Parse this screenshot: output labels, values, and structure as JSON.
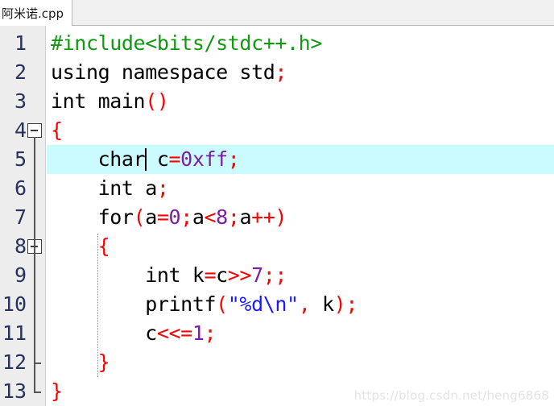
{
  "tab": {
    "label": "阿米诺.cpp"
  },
  "editor": {
    "highlighted_line": 5,
    "cursor_line": 5,
    "cursor_after_text": "    char",
    "colors": {
      "background": "#ffffff",
      "gutter_background": "#ededed",
      "line_number": "#26335c",
      "current_line_highlight": "#ccfbff",
      "preprocessor": "#119911",
      "punctuation": "#ff0000",
      "number": "#7b1fa2",
      "string": "#1a1aff",
      "plain": "#000000"
    },
    "lines": [
      {
        "number": "1",
        "fold": "none",
        "tokens": [
          {
            "text": "#include<bits/stdc++.h>",
            "type": "prep"
          }
        ]
      },
      {
        "number": "2",
        "fold": "none",
        "tokens": [
          {
            "text": "using namespace std",
            "type": "plain"
          },
          {
            "text": ";",
            "type": "punct"
          }
        ]
      },
      {
        "number": "3",
        "fold": "none",
        "tokens": [
          {
            "text": "int main",
            "type": "plain"
          },
          {
            "text": "()",
            "type": "punct"
          }
        ]
      },
      {
        "number": "4",
        "fold": "start",
        "tokens": [
          {
            "text": "{",
            "type": "punct"
          }
        ]
      },
      {
        "number": "5",
        "fold": "line",
        "tokens": [
          {
            "text": "    char c",
            "type": "plain"
          },
          {
            "text": "=",
            "type": "punct"
          },
          {
            "text": "0xff",
            "type": "num"
          },
          {
            "text": ";",
            "type": "punct"
          }
        ]
      },
      {
        "number": "6",
        "fold": "line",
        "tokens": [
          {
            "text": "    int a",
            "type": "plain"
          },
          {
            "text": ";",
            "type": "punct"
          }
        ]
      },
      {
        "number": "7",
        "fold": "line",
        "tokens": [
          {
            "text": "    for",
            "type": "plain"
          },
          {
            "text": "(",
            "type": "punct"
          },
          {
            "text": "a",
            "type": "plain"
          },
          {
            "text": "=",
            "type": "punct"
          },
          {
            "text": "0",
            "type": "num"
          },
          {
            "text": ";",
            "type": "punct"
          },
          {
            "text": "a",
            "type": "plain"
          },
          {
            "text": "<",
            "type": "punct"
          },
          {
            "text": "8",
            "type": "num"
          },
          {
            "text": ";",
            "type": "punct"
          },
          {
            "text": "a",
            "type": "plain"
          },
          {
            "text": "++)",
            "type": "punct"
          }
        ]
      },
      {
        "number": "8",
        "fold": "start",
        "tokens": [
          {
            "text": "    ",
            "type": "plain"
          },
          {
            "text": "{",
            "type": "punct"
          }
        ]
      },
      {
        "number": "9",
        "fold": "line",
        "tokens": [
          {
            "text": "        int k",
            "type": "plain"
          },
          {
            "text": "=",
            "type": "punct"
          },
          {
            "text": "c",
            "type": "plain"
          },
          {
            "text": ">>",
            "type": "punct"
          },
          {
            "text": "7",
            "type": "num"
          },
          {
            "text": ";;",
            "type": "punct"
          }
        ]
      },
      {
        "number": "10",
        "fold": "line",
        "tokens": [
          {
            "text": "        printf",
            "type": "plain"
          },
          {
            "text": "(",
            "type": "punct"
          },
          {
            "text": "\"%d\\n\"",
            "type": "str"
          },
          {
            "text": ",",
            "type": "punct"
          },
          {
            "text": " k",
            "type": "plain"
          },
          {
            "text": ");",
            "type": "punct"
          }
        ]
      },
      {
        "number": "11",
        "fold": "line",
        "tokens": [
          {
            "text": "        c",
            "type": "plain"
          },
          {
            "text": "<<=",
            "type": "punct"
          },
          {
            "text": "1",
            "type": "num"
          },
          {
            "text": ";",
            "type": "punct"
          }
        ]
      },
      {
        "number": "12",
        "fold": "end-inner",
        "tokens": [
          {
            "text": "    ",
            "type": "plain"
          },
          {
            "text": "}",
            "type": "punct"
          }
        ]
      },
      {
        "number": "13",
        "fold": "end-outer",
        "tokens": [
          {
            "text": "}",
            "type": "punct"
          }
        ]
      }
    ]
  },
  "watermark": {
    "text": "https://blog.csdn.net/heng6868"
  }
}
